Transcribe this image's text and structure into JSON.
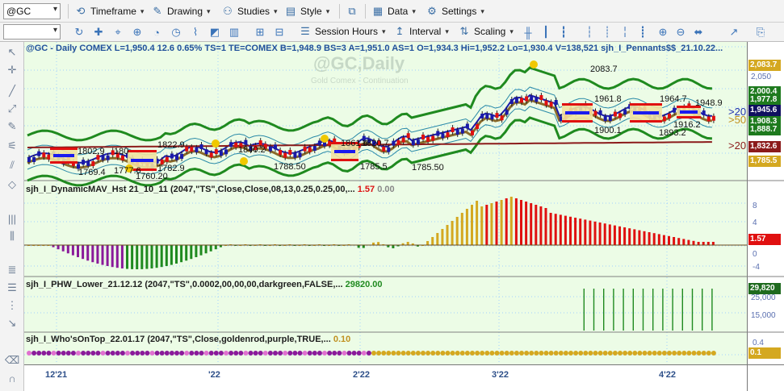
{
  "toolbar": {
    "symbol": "@GC",
    "menus": [
      {
        "label": "Timeframe",
        "icon": "timeframe-icon"
      },
      {
        "label": "Drawing",
        "icon": "pencil-icon"
      },
      {
        "label": "Studies",
        "icon": "studies-icon"
      },
      {
        "label": "Style",
        "icon": "style-icon"
      },
      {
        "label": "Data",
        "icon": "data-icon"
      },
      {
        "label": "Settings",
        "icon": "gear-icon"
      }
    ],
    "row2": {
      "session": "Session Hours",
      "interval": "Interval",
      "scaling": "Scaling"
    }
  },
  "chart": {
    "header": "@GC - Daily  COMEX  L=1,950.4  12.6  0.65%  TS=1  TE=COMEX  B=1,948.9  BS=3  A=1,951.0  AS=1  O=1,934.3  Hi=1,952.2  Lo=1,930.4  V=138,521  sjh_I_Pennants$$_21.10.22...",
    "watermark": "@GC,Daily",
    "watermark_sub": "Gold Comex - Continuation",
    "annotations": [
      "2083.7",
      "1961.8",
      "1964.7",
      "1948.9",
      "1900.1",
      "1893.2",
      "1916.2",
      "1822.9",
      "1840.2",
      "1861.4",
      "1820.7",
      "1802.9",
      "1769.4",
      "1760.20",
      "1782.9",
      "1788.50",
      "1785.5",
      "1785.50",
      "180",
      "1777.6"
    ],
    "right_markers": [
      ">20",
      ">50",
      ">20"
    ],
    "price_tags": [
      {
        "label": "2,083.7",
        "color": "#d4a820"
      },
      {
        "label": "2,050",
        "color": ""
      },
      {
        "label": "2,000.4",
        "color": "#1e7a1e"
      },
      {
        "label": "1,977.8",
        "color": "#1e7a1e"
      },
      {
        "label": "1,945.6",
        "color": "#101060"
      },
      {
        "label": "1,908.3",
        "color": "#1e7a1e"
      },
      {
        "label": "1,888.7",
        "color": "#1e7a1e"
      },
      {
        "label": "1,832.6",
        "color": "#8b1a1a"
      },
      {
        "label": "1,785.5",
        "color": "#d4a820"
      }
    ]
  },
  "indicators": {
    "dmav": {
      "label": "sjh_I_DynamicMAV_Hst 21_10_11 (2047,\"TS\",Close,Close,08,13,0.25,0.25,00,...",
      "v1": "1.57",
      "v2": "0.00",
      "tag": "1.57",
      "axis": [
        "8",
        "4",
        "0",
        "-4"
      ]
    },
    "phw": {
      "label": "sjh_I_PHW_Lower_21.12.12 (2047,\"TS\",0.0002,00,00,00,darkgreen,FALSE,...",
      "v1": "29820.00",
      "tag": "29,820",
      "axis": [
        "25,000",
        "15,000"
      ]
    },
    "who": {
      "label": "sjh_I_Who'sOnTop_22.01.17 (2047,\"TS\",Close,goldenrod,purple,TRUE,...",
      "v1": "0.10",
      "tag": "0.1",
      "axis": [
        "0.4"
      ]
    }
  },
  "time_axis": [
    "12'21",
    "'22",
    "2'22",
    "3'22",
    "4'22"
  ],
  "colors": {
    "background": "#ecfce6",
    "bull": "#1a1aaa",
    "bear": "#e01010",
    "gold": "#d4a820",
    "purple": "#8a1a9a",
    "green": "#1f8a1f",
    "channel": "#1f8a1f"
  }
}
